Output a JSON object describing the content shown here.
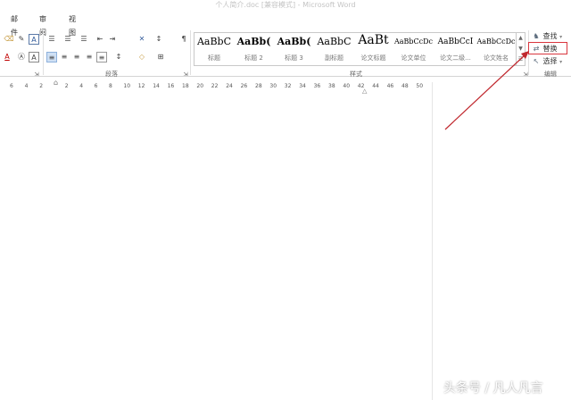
{
  "window": {
    "title": "个人简介.doc [兼容模式] - Microsoft Word"
  },
  "tabs": [
    "邮件",
    "审阅",
    "视图"
  ],
  "groups": {
    "paragraph": "段落",
    "styles": "样式",
    "editing": "编辑"
  },
  "styles": [
    {
      "sample": "AaBbC",
      "name": "标题"
    },
    {
      "sample": "AaBb(",
      "name": "标题 2"
    },
    {
      "sample": "AaBb(",
      "name": "标题 3"
    },
    {
      "sample": "AaBbC",
      "name": "副标题"
    },
    {
      "sample": "AaBt",
      "name": "论文标题"
    },
    {
      "sample": "AaBbCcDc",
      "name": "论文单位"
    },
    {
      "sample": "AaBbCcI",
      "name": "论文二级..."
    },
    {
      "sample": "AaBbCcDc",
      "name": "论文姓名"
    }
  ],
  "editing": {
    "find": "查找",
    "replace": "替换",
    "select": "选择"
  },
  "ruler": [
    "6",
    "4",
    "2",
    "2",
    "4",
    "6",
    "8",
    "10",
    "12",
    "14",
    "16",
    "18",
    "20",
    "22",
    "24",
    "26",
    "28",
    "30",
    "32",
    "34",
    "36",
    "38",
    "40",
    "42",
    "44",
    "46",
    "48",
    "50"
  ],
  "watermark": "头条号 / 凡人凡言",
  "colors": {
    "highlight_box": "#d9363e",
    "arrow": "#c0272d"
  }
}
